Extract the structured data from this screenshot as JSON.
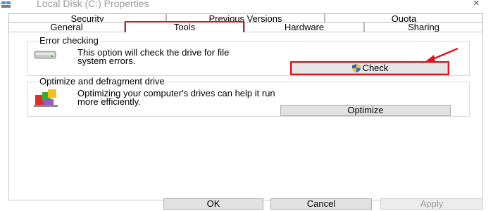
{
  "window": {
    "title": "Local Disk (C:) Properties",
    "close_glyph": "×"
  },
  "tabs": {
    "back_row": [
      "Security",
      "Previous Versions",
      "Quota"
    ],
    "front_row": [
      "General",
      "Tools",
      "Hardware",
      "Sharing"
    ],
    "active": "Tools"
  },
  "error_checking": {
    "title": "Error checking",
    "description_line1": "This option will check the drive for file",
    "description_line2": "system errors.",
    "button_label": "Check",
    "icon": "hard-drive-icon",
    "button_icon": "uac-shield-icon"
  },
  "optimize": {
    "title": "Optimize and defragment drive",
    "description_line1": "Optimizing your computer's drives can help it run",
    "description_line2": "more efficiently.",
    "button_label": "Optimize",
    "icon": "defragment-icon"
  },
  "footer": {
    "ok_label": "OK",
    "cancel_label": "Cancel",
    "apply_label": "Apply"
  },
  "colors": {
    "highlight": "#e0141c",
    "button_face": "#e1e1e1",
    "disabled_text": "#9b9b9b"
  }
}
